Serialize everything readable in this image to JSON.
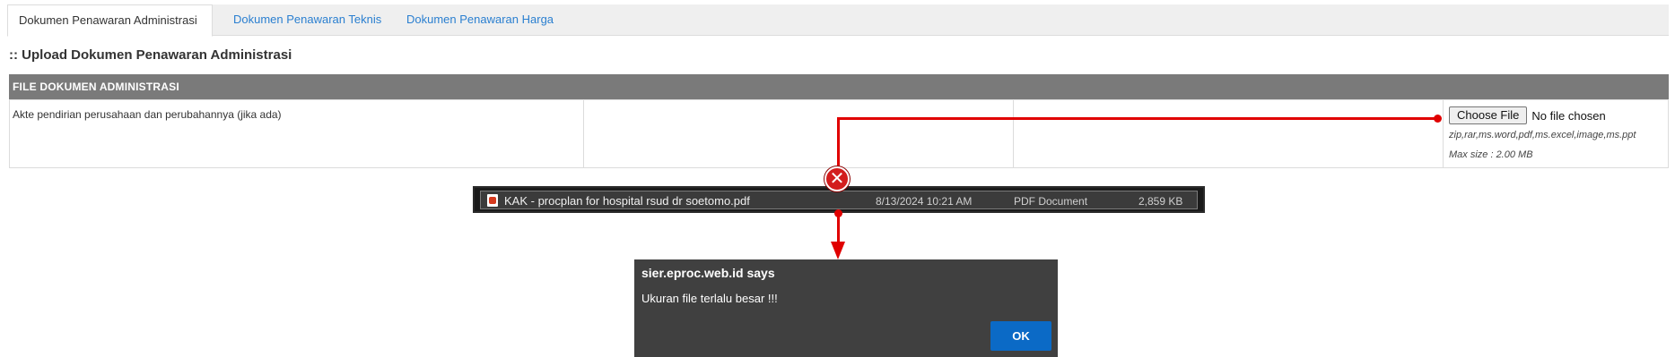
{
  "tabs": [
    {
      "label": "Dokumen Penawaran Administrasi",
      "active": true
    },
    {
      "label": "Dokumen Penawaran Teknis",
      "active": false
    },
    {
      "label": "Dokumen Penawaran Harga",
      "active": false
    }
  ],
  "section_title": ":: Upload Dokumen Penawaran Administrasi",
  "table": {
    "header": "FILE DOKUMEN ADMINISTRASI",
    "rows": [
      {
        "document": "Akte pendirian perusahaan dan perubahannya (jika ada)",
        "upload": {
          "button_label": "Choose File",
          "status": "No file chosen",
          "allowed_types": "zip,rar,ms.word,pdf,ms.excel,image,ms.ppt",
          "max_size": "Max size : 2.00 MB"
        }
      }
    ]
  },
  "file_explorer": {
    "name": "KAK - procplan for hospital rsud dr soetomo.pdf",
    "date": "8/13/2024 10:21 AM",
    "type": "PDF Document",
    "size": "2,859 KB",
    "icon": "pdf-file-icon"
  },
  "annotation": {
    "color": "#e00000",
    "error_icon": "error-x-icon"
  },
  "dialog": {
    "title": "sier.eproc.web.id says",
    "message": "Ukuran file terlalu besar !!!",
    "ok_label": "OK"
  },
  "colors": {
    "tab_link": "#2a7fd0",
    "table_header_bg": "#7a7a7a",
    "dialog_bg": "#404040",
    "ok_button": "#0b6ac6"
  }
}
